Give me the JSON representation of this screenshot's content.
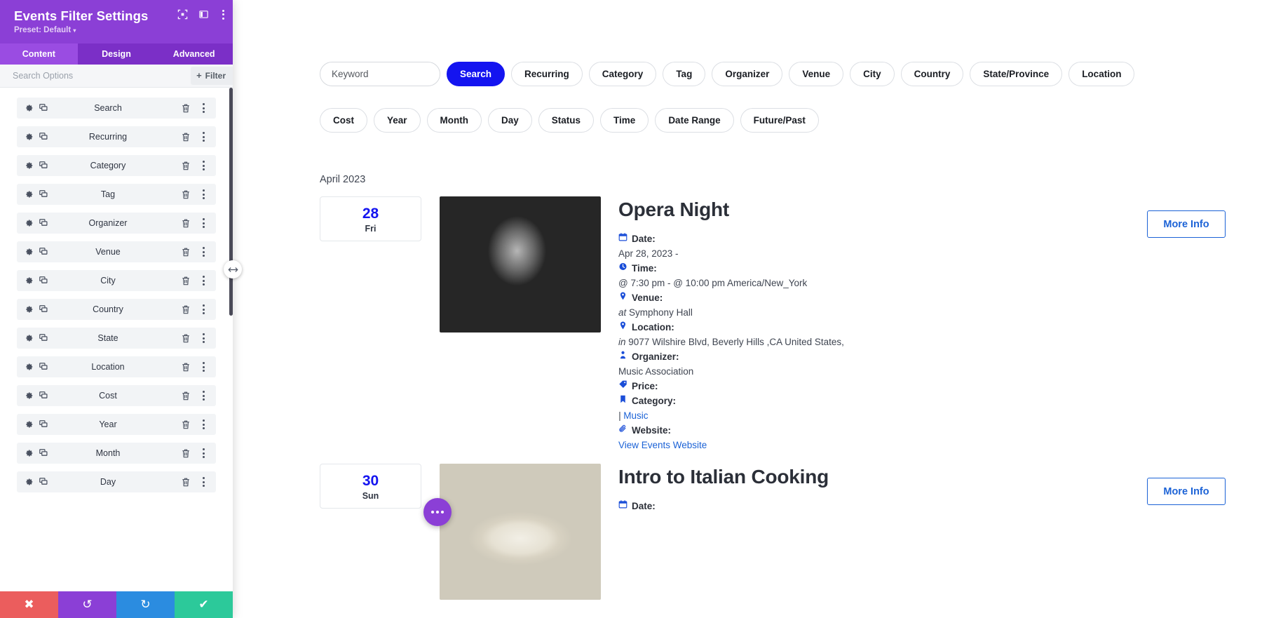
{
  "panel": {
    "title": "Events Filter Settings",
    "preset_label": "Preset: Default",
    "preset_caret": "▾",
    "tabs": [
      {
        "label": "Content",
        "active": true
      },
      {
        "label": "Design",
        "active": false
      },
      {
        "label": "Advanced",
        "active": false
      }
    ],
    "search_placeholder": "Search Options",
    "search_value": "",
    "filter_button": "Filter",
    "filter_plus": "+",
    "options": [
      {
        "label": "Search"
      },
      {
        "label": "Recurring"
      },
      {
        "label": "Category"
      },
      {
        "label": "Tag"
      },
      {
        "label": "Organizer"
      },
      {
        "label": "Venue"
      },
      {
        "label": "City"
      },
      {
        "label": "Country"
      },
      {
        "label": "State"
      },
      {
        "label": "Location"
      },
      {
        "label": "Cost"
      },
      {
        "label": "Year"
      },
      {
        "label": "Month"
      },
      {
        "label": "Day"
      }
    ],
    "footer": {
      "cancel": "✖",
      "undo": "↺",
      "redo": "↻",
      "save": "✔"
    },
    "colors": {
      "header": "#8b3fd6",
      "tab_active": "#9a4ce2",
      "cancel": "#eb5d5d",
      "undo": "#8b3fd6",
      "redo": "#2b8ce0",
      "save": "#2cc99a"
    }
  },
  "preview": {
    "keyword_placeholder": "Keyword",
    "keyword_value": "",
    "filters_row1": [
      {
        "label": "Search",
        "primary": true
      },
      {
        "label": "Recurring",
        "primary": false
      },
      {
        "label": "Category",
        "primary": false
      },
      {
        "label": "Tag",
        "primary": false
      },
      {
        "label": "Organizer",
        "primary": false
      },
      {
        "label": "Venue",
        "primary": false
      },
      {
        "label": "City",
        "primary": false
      },
      {
        "label": "Country",
        "primary": false
      },
      {
        "label": "State/Province",
        "primary": false
      },
      {
        "label": "Location",
        "primary": false
      }
    ],
    "filters_row2": [
      {
        "label": "Cost"
      },
      {
        "label": "Year"
      },
      {
        "label": "Month"
      },
      {
        "label": "Day"
      },
      {
        "label": "Status"
      },
      {
        "label": "Time"
      },
      {
        "label": "Date Range"
      },
      {
        "label": "Future/Past"
      }
    ],
    "month_heading": "April 2023",
    "accent_color": "#1414f0",
    "link_color": "#1b62d6",
    "events": [
      {
        "day": "28",
        "weekday": "Fri",
        "title": "Opera Night",
        "more_info": "More Info",
        "photo": "opera",
        "meta": [
          {
            "icon": "calendar-icon",
            "label": "Date:",
            "value": "Apr 28, 2023 -",
            "prefix": ""
          },
          {
            "icon": "clock-icon",
            "label": "Time:",
            "value": "@ 7:30 pm - @ 10:00 pm America/New_York",
            "prefix": ""
          },
          {
            "icon": "map-pin-icon",
            "label": "Venue:",
            "value": "Symphony Hall",
            "prefix": "at"
          },
          {
            "icon": "map-pin-icon",
            "label": "Location:",
            "value": "9077 Wilshire Blvd, Beverly Hills ,CA United States,",
            "prefix": "in"
          },
          {
            "icon": "person-icon",
            "label": "Organizer:",
            "value": "Music Association",
            "prefix": ""
          },
          {
            "icon": "price-tag-icon",
            "label": "Price:",
            "value": "",
            "prefix": ""
          },
          {
            "icon": "bookmark-icon",
            "label": "Category:",
            "value": "Music",
            "prefix": "|",
            "is_link": true
          },
          {
            "icon": "paperclip-icon",
            "label": "Website:",
            "value": "View Events Website",
            "prefix": "",
            "is_link": true
          }
        ]
      },
      {
        "day": "30",
        "weekday": "Sun",
        "title": "Intro to Italian Cooking",
        "more_info": "More Info",
        "photo": "food",
        "meta": [
          {
            "icon": "calendar-icon",
            "label": "Date:",
            "value": "",
            "prefix": ""
          }
        ]
      }
    ]
  }
}
